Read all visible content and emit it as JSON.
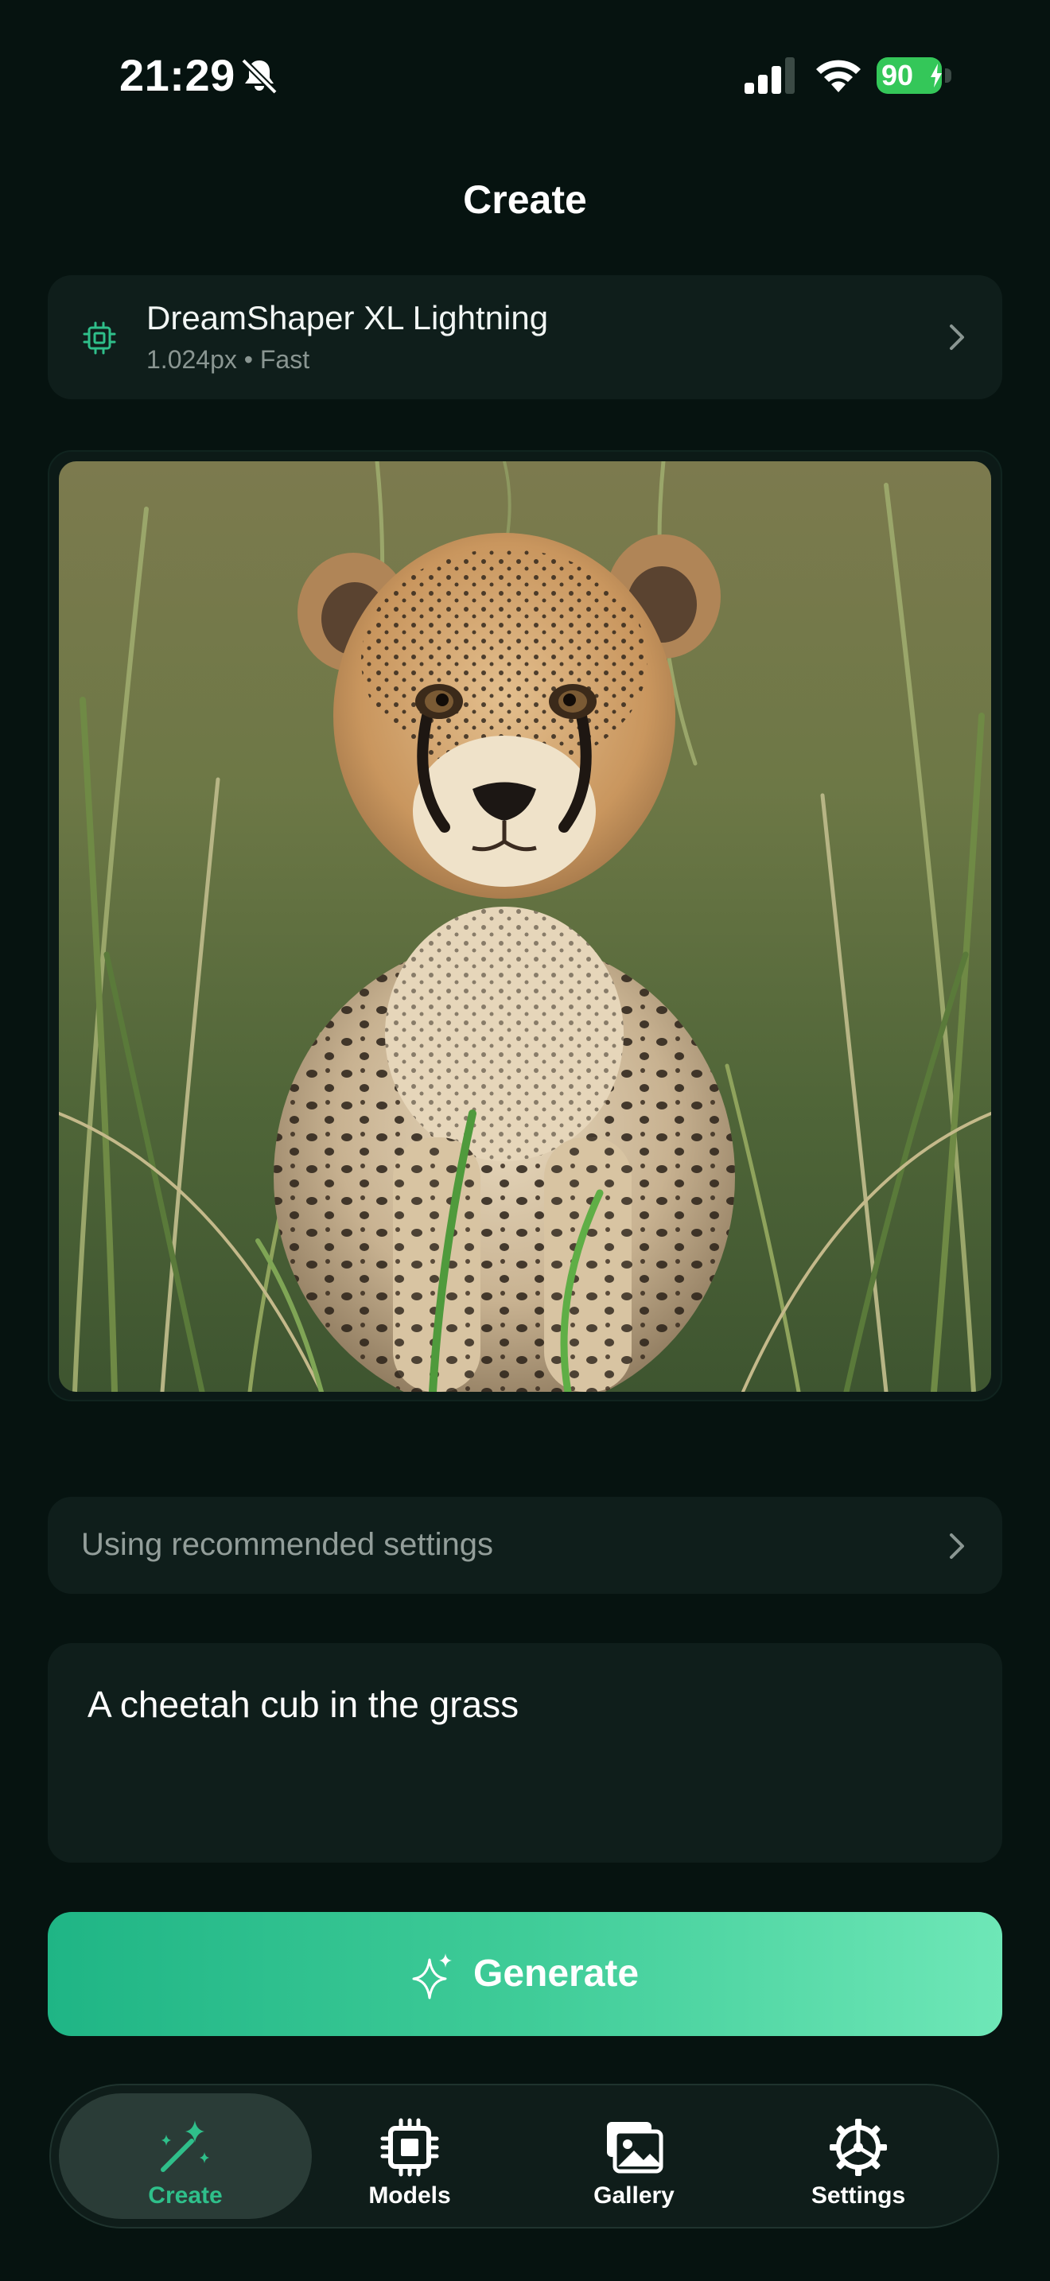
{
  "status_bar": {
    "time": "21:29",
    "battery": "90"
  },
  "header": {
    "title": "Create"
  },
  "model_card": {
    "name": "DreamShaper XL Lightning",
    "meta": "1.024px • Fast"
  },
  "settings": {
    "label": "Using recommended settings"
  },
  "prompt": {
    "text": "A cheetah cub in the grass"
  },
  "generate": {
    "label": "Generate"
  },
  "tabs": [
    {
      "label": "Create",
      "icon": "magic-wand-icon",
      "active": true
    },
    {
      "label": "Models",
      "icon": "chip-icon",
      "active": false
    },
    {
      "label": "Gallery",
      "icon": "gallery-icon",
      "active": false
    },
    {
      "label": "Settings",
      "icon": "gear-icon",
      "active": false
    }
  ],
  "colors": {
    "background": "#061310",
    "card": "#0f1e1b",
    "accent": "#2fbf8a",
    "battery": "#34c759"
  }
}
